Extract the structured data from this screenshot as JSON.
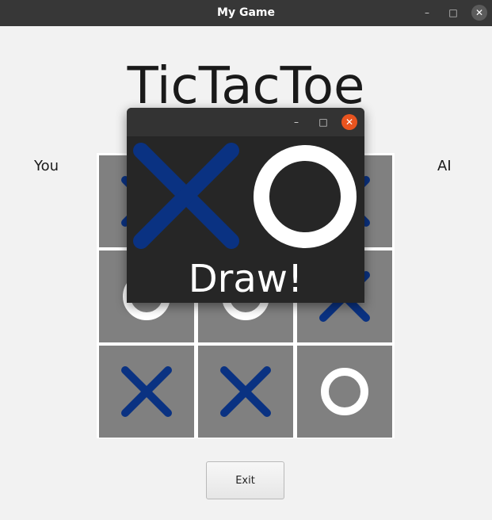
{
  "window": {
    "title": "My Game",
    "controls": [
      "minimize-icon",
      "maximize-icon",
      "close-icon"
    ]
  },
  "game": {
    "heading": "TicTacToe",
    "player_label": "You",
    "opponent_label": "AI",
    "exit_label": "Exit",
    "colors": {
      "x": "#0a3282",
      "o": "#ffffff",
      "cell": "#808080",
      "background": "#f2f2f2"
    },
    "board": [
      "X",
      "",
      "X",
      "O",
      "O",
      "X",
      "X",
      "X",
      "O"
    ]
  },
  "dialog": {
    "result_text": "Draw!",
    "icons": [
      "x-mark-icon",
      "o-mark-icon"
    ],
    "controls": [
      "minimize-icon",
      "maximize-icon",
      "close-icon"
    ]
  }
}
